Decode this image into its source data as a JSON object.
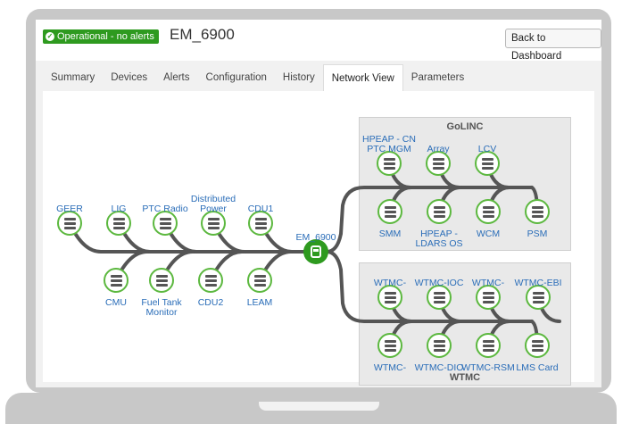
{
  "status": {
    "text": "Operational - no alerts",
    "color": "#2e9a1f"
  },
  "device": {
    "name": "EM_6900"
  },
  "header": {
    "back_label": "Back to Dashboard"
  },
  "tabs": [
    {
      "label": "Summary"
    },
    {
      "label": "Devices"
    },
    {
      "label": "Alerts"
    },
    {
      "label": "Configuration"
    },
    {
      "label": "History"
    },
    {
      "label": "Network View",
      "active": true
    },
    {
      "label": "Parameters"
    }
  ],
  "network": {
    "hub": {
      "label": "EM_6900"
    },
    "left_top": [
      "GEER",
      "LIG",
      "PTC Radio",
      "Distributed Power",
      "CDU1"
    ],
    "left_bottom": [
      "CMU",
      "Fuel Tank Monitor",
      "CDU2",
      "LEAM"
    ],
    "golinc": {
      "title": "GoLINC",
      "top": [
        "HPEAP - CN PTC MGM",
        "Array",
        "LCV"
      ],
      "bottom": [
        "SMM",
        "HPEAP - LDARS OS",
        "WCM",
        "PSM"
      ]
    },
    "wtmc": {
      "title": "WTMC",
      "top": [
        "WTMC-",
        "WTMC-IOC",
        "WTMC-",
        "WTMC-EBI"
      ],
      "bottom": [
        "WTMC-",
        "WTMC-DIO",
        "WTMC-RSM",
        "LMS Card"
      ]
    },
    "colors": {
      "node_ring": "#5cb83f",
      "link": "#555555",
      "label": "#2a6db8",
      "hub": "#2e9a1f"
    }
  }
}
